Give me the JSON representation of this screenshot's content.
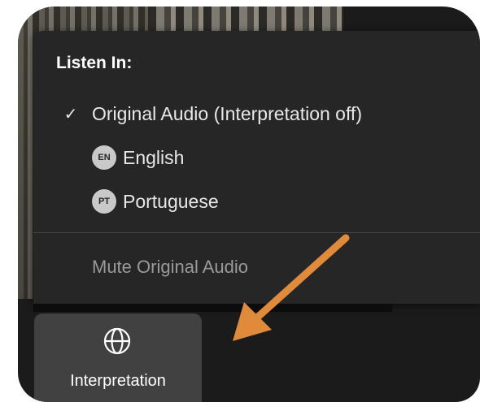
{
  "menu": {
    "title": "Listen In:",
    "original_audio": {
      "label": "Original Audio (Interpretation off)",
      "checked": true
    },
    "languages": [
      {
        "code": "EN",
        "label": "English"
      },
      {
        "code": "PT",
        "label": "Portuguese"
      }
    ],
    "mute_label": "Mute Original Audio"
  },
  "toolbar": {
    "interpretation_label": "Interpretation",
    "interpretation_icon": "globe-icon"
  },
  "colors": {
    "menu_bg": "#262626",
    "button_bg": "#414141",
    "annotation_arrow": "#e08a3c"
  }
}
